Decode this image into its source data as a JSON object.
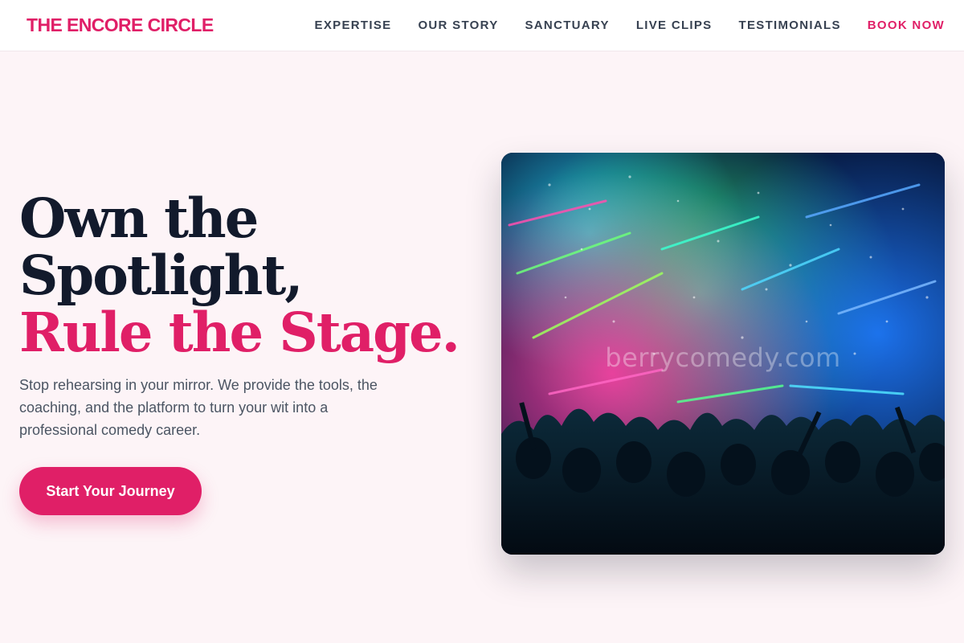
{
  "brand": {
    "name": "THE ENCORE CIRCLE",
    "accent_color": "#e01f67"
  },
  "nav": {
    "items": [
      {
        "label": "EXPERTISE"
      },
      {
        "label": "OUR STORY"
      },
      {
        "label": "SANCTUARY"
      },
      {
        "label": "LIVE CLIPS"
      },
      {
        "label": "TESTIMONIALS"
      }
    ],
    "cta_label": "BOOK NOW"
  },
  "hero": {
    "headline_line1": "Own the",
    "headline_line2": "Spotlight,",
    "headline_accent": "Rule the Stage.",
    "subcopy": "Stop rehearsing in your mirror. We provide the tools, the coaching, and the platform to turn your wit into a professional comedy career.",
    "cta_label": "Start Your Journey",
    "image": {
      "watermark": "berrycomedy.com"
    }
  }
}
